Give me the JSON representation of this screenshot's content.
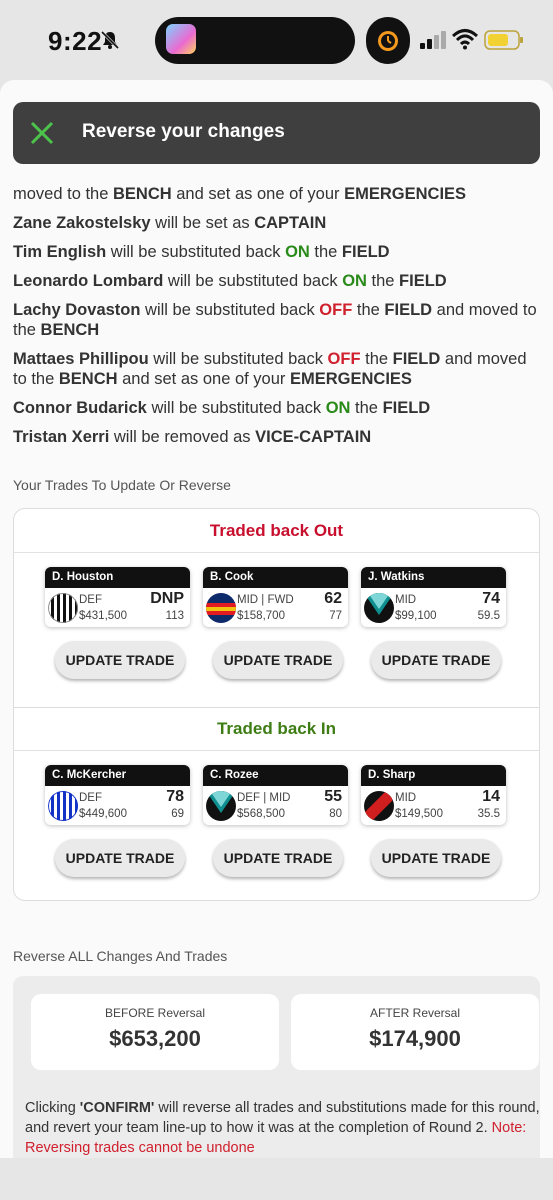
{
  "status_bar": {
    "time": "9:22",
    "icons": [
      "bell-muted-icon",
      "app-icon",
      "alarm-icon",
      "signal-icon",
      "wifi-icon",
      "battery-icon"
    ]
  },
  "banner": {
    "title": "Reverse your changes",
    "icon": "close-x-icon",
    "accent": "#4cc34a"
  },
  "changes": [
    {
      "segments": [
        {
          "t": "moved to the ",
          "s": "n"
        },
        {
          "t": "BENCH",
          "s": "b"
        },
        {
          "t": " and set as one of your ",
          "s": "n"
        },
        {
          "t": "EMERGENCIES",
          "s": "b"
        }
      ]
    },
    {
      "segments": [
        {
          "t": "Zane Zakostelsky",
          "s": "b"
        },
        {
          "t": " will be set as ",
          "s": "n"
        },
        {
          "t": "CAPTAIN",
          "s": "b"
        }
      ]
    },
    {
      "segments": [
        {
          "t": "Tim English",
          "s": "b"
        },
        {
          "t": " will be substituted back ",
          "s": "n"
        },
        {
          "t": "ON",
          "s": "g"
        },
        {
          "t": " the ",
          "s": "n"
        },
        {
          "t": "FIELD",
          "s": "b"
        }
      ]
    },
    {
      "segments": [
        {
          "t": "Leonardo Lombard",
          "s": "b"
        },
        {
          "t": " will be substituted back ",
          "s": "n"
        },
        {
          "t": "ON",
          "s": "g"
        },
        {
          "t": " the ",
          "s": "n"
        },
        {
          "t": "FIELD",
          "s": "b"
        }
      ]
    },
    {
      "segments": [
        {
          "t": "Lachy Dovaston",
          "s": "b"
        },
        {
          "t": " will be substituted back ",
          "s": "n"
        },
        {
          "t": "OFF",
          "s": "r"
        },
        {
          "t": " the ",
          "s": "n"
        },
        {
          "t": "FIELD",
          "s": "b"
        },
        {
          "t": " and moved to the ",
          "s": "n"
        },
        {
          "t": "BENCH",
          "s": "b"
        }
      ]
    },
    {
      "segments": [
        {
          "t": "Mattaes Phillipou",
          "s": "b"
        },
        {
          "t": " will be substituted back ",
          "s": "n"
        },
        {
          "t": "OFF",
          "s": "r"
        },
        {
          "t": " the ",
          "s": "n"
        },
        {
          "t": "FIELD",
          "s": "b"
        },
        {
          "t": " and moved to the ",
          "s": "n"
        },
        {
          "t": "BENCH",
          "s": "b"
        },
        {
          "t": " and set as one of your ",
          "s": "n"
        },
        {
          "t": "EMERGENCIES",
          "s": "b"
        }
      ]
    },
    {
      "segments": [
        {
          "t": "Connor Budarick",
          "s": "b"
        },
        {
          "t": " will be substituted back ",
          "s": "n"
        },
        {
          "t": "ON",
          "s": "g"
        },
        {
          "t": " the ",
          "s": "n"
        },
        {
          "t": "FIELD",
          "s": "b"
        }
      ]
    },
    {
      "segments": [
        {
          "t": "Tristan Xerri",
          "s": "b"
        },
        {
          "t": " will be removed as ",
          "s": "n"
        },
        {
          "t": "VICE-CAPTAIN",
          "s": "b"
        }
      ]
    }
  ],
  "trades_section": {
    "title": "Your Trades To Update Or Reverse",
    "update_label": "UPDATE TRADE",
    "out": {
      "heading": "Traded back Out",
      "players": [
        {
          "name": "D. Houston",
          "pos": "DEF",
          "price": "$431,500",
          "score": "DNP",
          "avg": "113",
          "guernsey": "stripes-bw"
        },
        {
          "name": "B. Cook",
          "pos": "MID | FWD",
          "price": "$158,700",
          "score": "62",
          "avg": "77",
          "guernsey": "adelaide"
        },
        {
          "name": "J. Watkins",
          "pos": "MID",
          "price": "$99,100",
          "score": "74",
          "avg": "59.5",
          "guernsey": "vee-teal"
        }
      ]
    },
    "in": {
      "heading": "Traded back In",
      "players": [
        {
          "name": "C. McKercher",
          "pos": "DEF",
          "price": "$449,600",
          "score": "78",
          "avg": "69",
          "guernsey": "stripes-bluewhite"
        },
        {
          "name": "C. Rozee",
          "pos": "DEF | MID",
          "price": "$568,500",
          "score": "55",
          "avg": "80",
          "guernsey": "vee-teal"
        },
        {
          "name": "D. Sharp",
          "pos": "MID",
          "price": "$149,500",
          "score": "14",
          "avg": "35.5",
          "guernsey": "sash-redblack"
        }
      ]
    }
  },
  "reverse_section": {
    "title": "Reverse ALL Changes And Trades",
    "before_label": "BEFORE Reversal",
    "before_value": "$653,200",
    "after_label": "AFTER Reversal",
    "after_value": "$174,900",
    "confirm_prefix": "Clicking ",
    "confirm_word": "'CONFIRM'",
    "confirm_rest": " will reverse all trades and substitutions made for this round, and revert your team line-up to how it was at the completion of Round 2.",
    "note": "Note: Reversing trades cannot be undone"
  },
  "colors": {
    "out_heading": "#c8102e",
    "in_heading": "#3e7d14",
    "on": "#2a8a1a",
    "off": "#d0202e"
  }
}
